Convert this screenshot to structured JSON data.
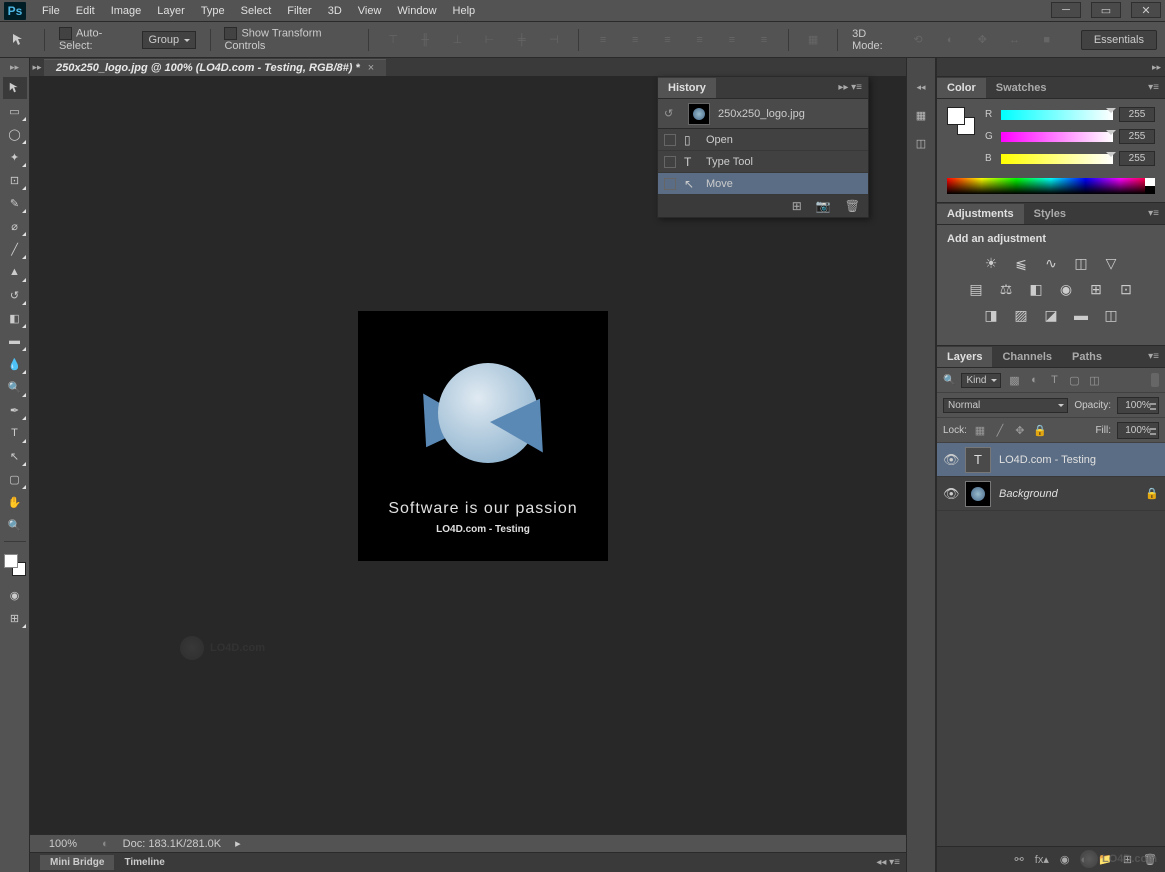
{
  "app": {
    "logo": "Ps"
  },
  "menu": [
    "File",
    "Edit",
    "Image",
    "Layer",
    "Type",
    "Select",
    "Filter",
    "3D",
    "View",
    "Window",
    "Help"
  ],
  "optbar": {
    "auto_select": "Auto-Select:",
    "group": "Group",
    "show_transform": "Show Transform Controls",
    "mode_3d": "3D Mode:",
    "essentials": "Essentials"
  },
  "doc": {
    "tab": "250x250_logo.jpg @ 100% (LO4D.com - Testing, RGB/8#) *",
    "artboard_t1": "Software is our passion",
    "artboard_t2": "LO4D.com - Testing",
    "watermark": "LO4D.com"
  },
  "status": {
    "zoom": "100%",
    "doc": "Doc: 183.1K/281.0K"
  },
  "bottom_tabs": [
    "Mini Bridge",
    "Timeline"
  ],
  "history": {
    "title": "History",
    "source": "250x250_logo.jpg",
    "items": [
      {
        "icon": "doc",
        "label": "Open"
      },
      {
        "icon": "T",
        "label": "Type Tool"
      },
      {
        "icon": "move",
        "label": "Move"
      }
    ]
  },
  "color": {
    "tab1": "Color",
    "tab2": "Swatches",
    "r": {
      "lab": "R",
      "val": "255"
    },
    "g": {
      "lab": "G",
      "val": "255"
    },
    "b": {
      "lab": "B",
      "val": "255"
    }
  },
  "adjustments": {
    "tab1": "Adjustments",
    "tab2": "Styles",
    "title": "Add an adjustment"
  },
  "layers": {
    "tab1": "Layers",
    "tab2": "Channels",
    "tab3": "Paths",
    "kind": "Kind",
    "blend": "Normal",
    "opacity_lab": "Opacity:",
    "opacity": "100%",
    "lock_lab": "Lock:",
    "fill_lab": "Fill:",
    "fill": "100%",
    "items": [
      {
        "type": "T",
        "name": "LO4D.com - Testing",
        "sel": true
      },
      {
        "type": "bg",
        "name": "Background",
        "sel": false,
        "locked": true
      }
    ]
  },
  "corner_wm": "LO4D.com"
}
